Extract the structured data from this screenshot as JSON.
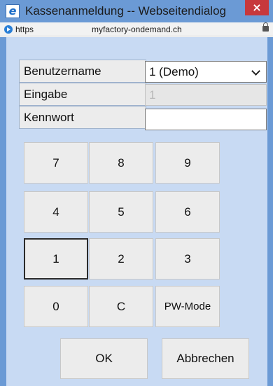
{
  "window": {
    "title": "Kassenanmeldung -- Webseitendialog",
    "close_glyph": "×"
  },
  "address_bar": {
    "protocol": "https",
    "host": "myfactory-ondemand.ch"
  },
  "form": {
    "username_label": "Benutzername",
    "username_value": "1 (Demo)",
    "input_label": "Eingabe",
    "input_value": "1",
    "password_label": "Kennwort",
    "password_value": ""
  },
  "keypad": {
    "keys": [
      "7",
      "8",
      "9",
      "4",
      "5",
      "6",
      "1",
      "2",
      "3",
      "0",
      "C",
      "PW-Mode"
    ]
  },
  "buttons": {
    "ok": "OK",
    "cancel": "Abbrechen"
  }
}
